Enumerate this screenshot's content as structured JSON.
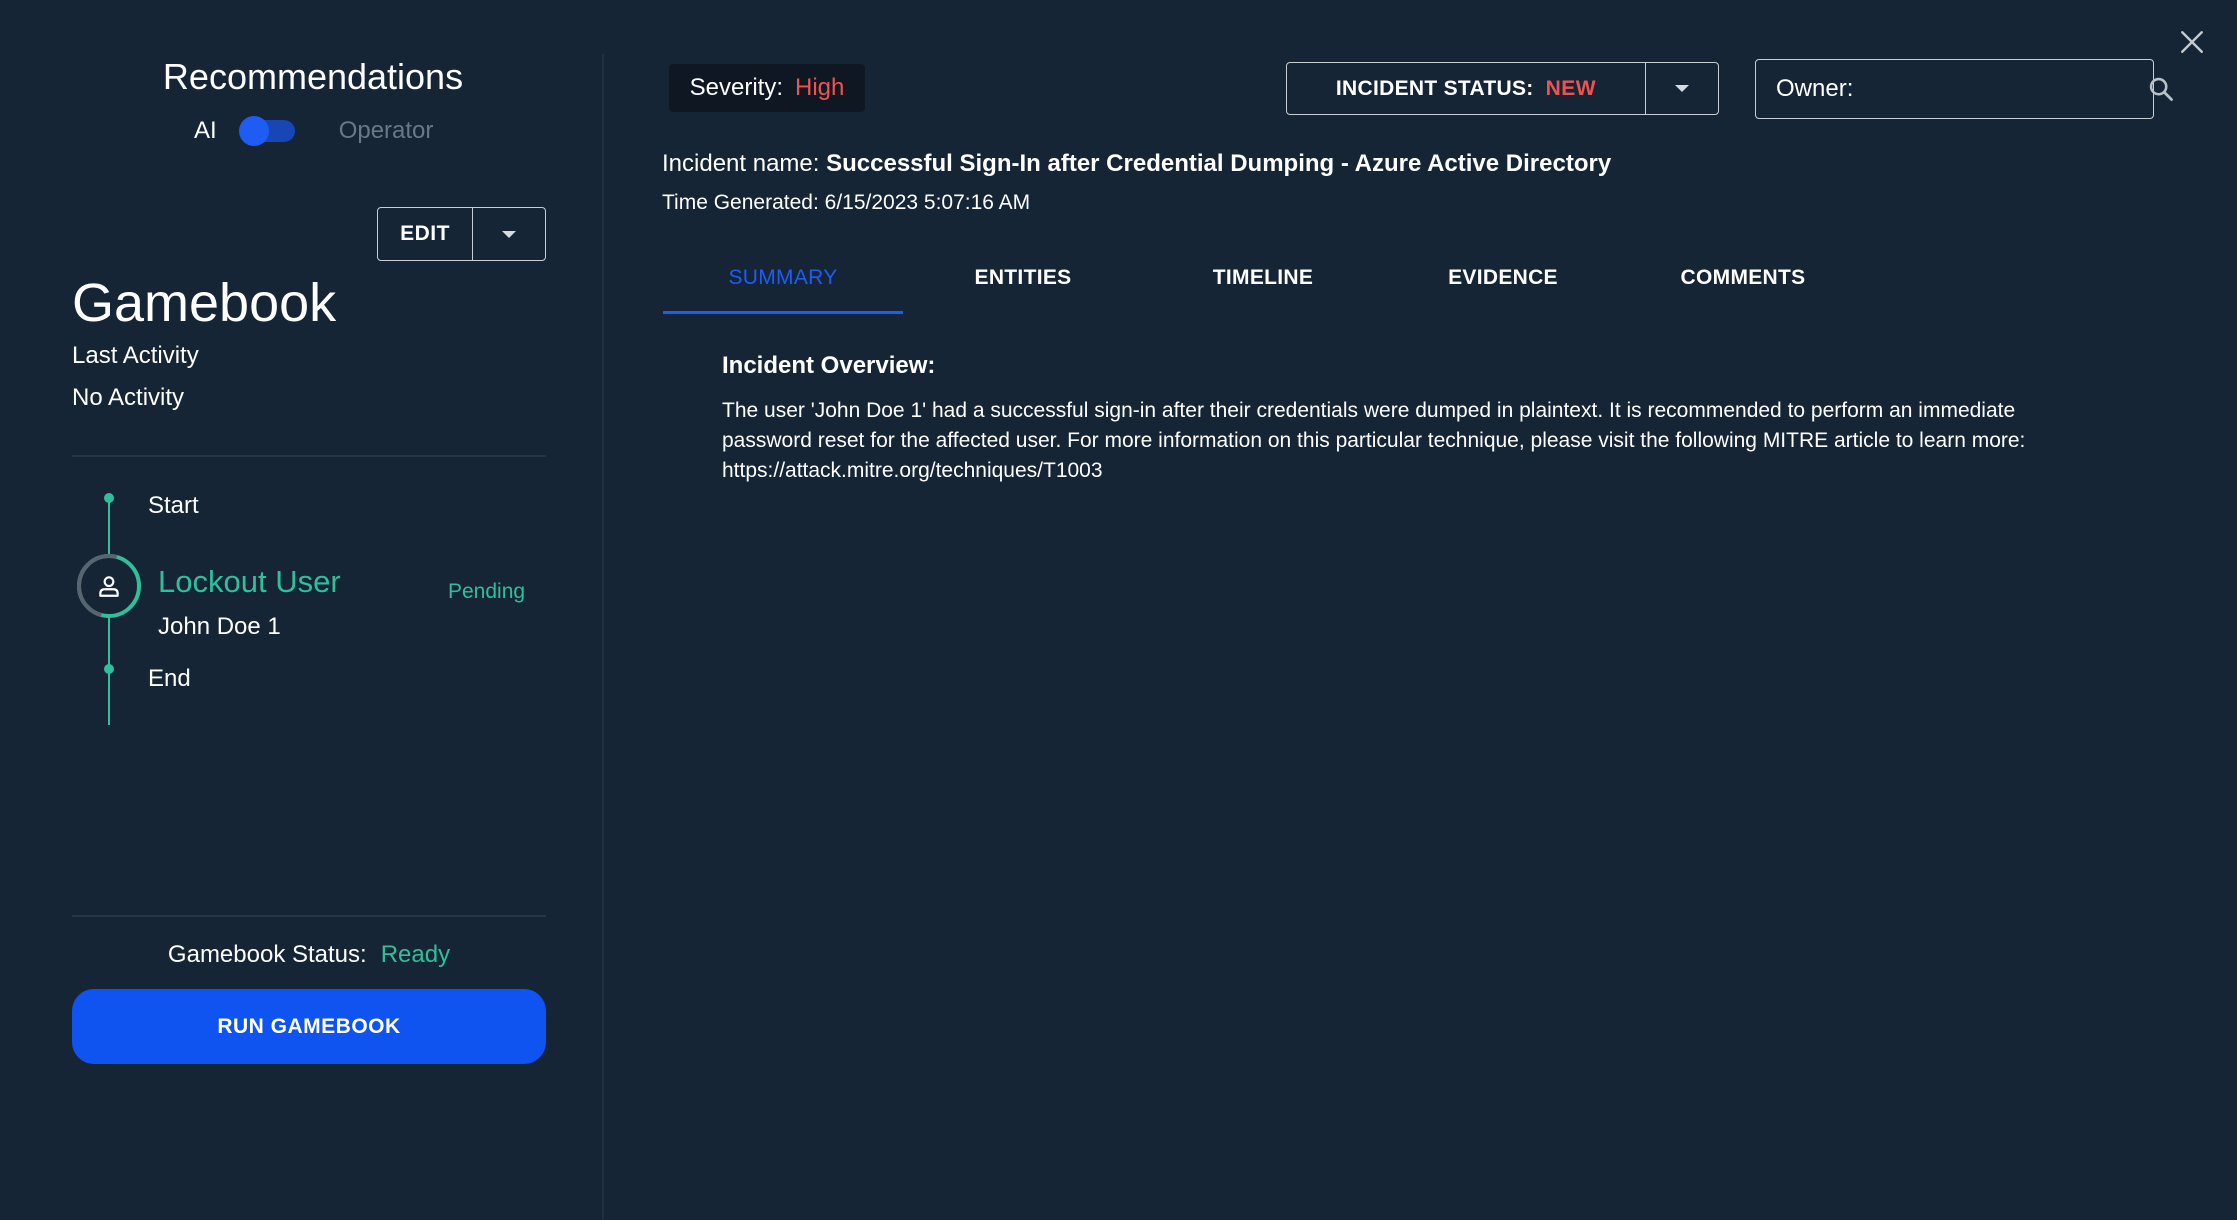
{
  "recommendations": {
    "title": "Recommendations",
    "toggle_left": "AI",
    "toggle_right": "Operator",
    "toggle_on": true
  },
  "edit_button": {
    "label": "EDIT"
  },
  "gamebook": {
    "title": "Gamebook",
    "last_activity_label": "Last Activity",
    "last_activity_value": "No Activity",
    "steps": {
      "start": "Start",
      "action": {
        "title": "Lockout User",
        "target": "John Doe 1",
        "status": "Pending"
      },
      "end": "End"
    },
    "status_label": "Gamebook Status:",
    "status_value": "Ready",
    "run_button": "RUN GAMEBOOK"
  },
  "header": {
    "severity_label": "Severity:",
    "severity_value": "High",
    "incident_status_label": "INCIDENT STATUS:",
    "incident_status_value": "NEW",
    "owner_label": "Owner:",
    "owner_value": ""
  },
  "incident": {
    "name_label": "Incident name:",
    "name_value": "Successful Sign-In after Credential Dumping - Azure Active Directory",
    "time_label": "Time Generated:",
    "time_value": "6/15/2023 5:07:16 AM"
  },
  "tabs": [
    {
      "label": "SUMMARY",
      "active": true
    },
    {
      "label": "ENTITIES",
      "active": false
    },
    {
      "label": "TIMELINE",
      "active": false
    },
    {
      "label": "EVIDENCE",
      "active": false
    },
    {
      "label": "COMMENTS",
      "active": false
    }
  ],
  "summary": {
    "overview_title": "Incident Overview:",
    "overview_text": "The user 'John Doe 1' had a successful sign-in after their credentials were dumped in plaintext. It is recommended to perform an immediate password reset for the affected user. For more information on this particular technique, please visit the following MITRE article to learn more: https://attack.mitre.org/techniques/T1003"
  },
  "colors": {
    "background": "#152535",
    "accent_blue": "#1e5cf4",
    "success_green": "#2fbf9a",
    "danger_red": "#f05252"
  },
  "icons": {
    "close": "close-icon",
    "search": "search-icon",
    "user": "user-icon",
    "caret": "chevron-down-icon"
  }
}
